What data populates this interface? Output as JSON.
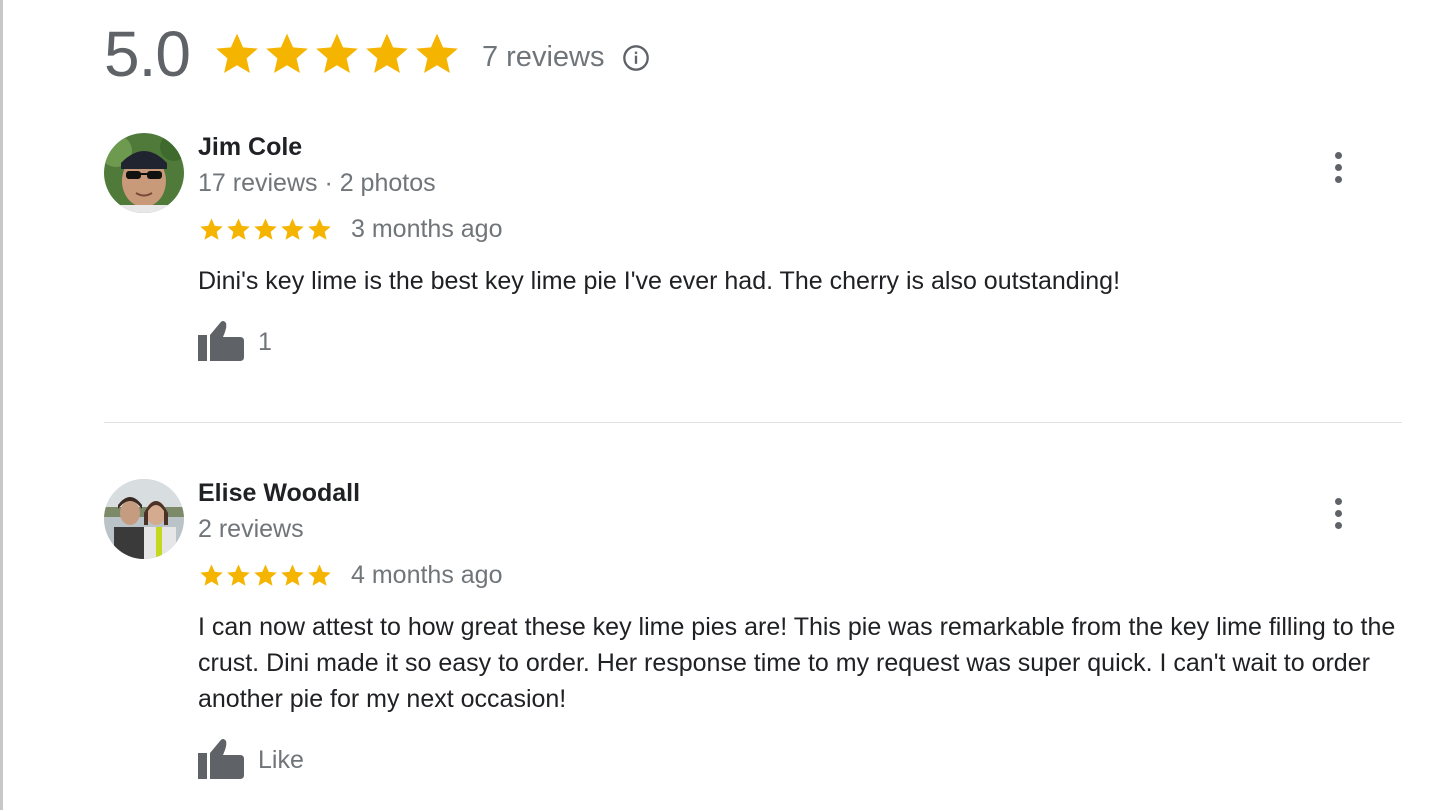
{
  "summary": {
    "score": "5.0",
    "stars": 5,
    "review_count": "7 reviews",
    "info_icon": "info-icon",
    "star_color": "#f4b400"
  },
  "reviews": [
    {
      "author": "Jim Cole",
      "meta": "17 reviews · 2 photos",
      "rating": 5,
      "date": "3 months ago",
      "text": "Dini's key lime is the best key lime pie I've ever had. The cherry is also outstanding!",
      "like_label": "1",
      "avatar_icon": "avatar-man-sunglasses"
    },
    {
      "author": "Elise Woodall",
      "meta": "2 reviews",
      "rating": 5,
      "date": "4 months ago",
      "text": "I can now attest to how great these key lime pies are! This pie was remarkable from the key lime filling to the crust. Dini made it so easy to order. Her response time to my request was super quick. I can't wait to order another pie for my next occasion!",
      "like_label": "Like",
      "avatar_icon": "avatar-two-women"
    }
  ],
  "colors": {
    "text_primary": "#202124",
    "text_secondary": "#70757a",
    "star": "#f4b400",
    "icon": "#5f6368"
  }
}
